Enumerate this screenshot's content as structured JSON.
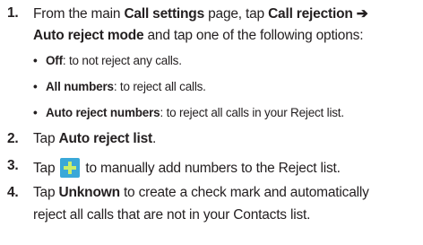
{
  "steps": [
    {
      "number": "1.",
      "line1": {
        "t1": "From the main ",
        "b1": "Call settings",
        "t2": " page, tap ",
        "b2": "Call rejection",
        "arrow": " ➔"
      },
      "line2": {
        "b1": "Auto reject mode",
        "t1": " and tap one of the following options:"
      },
      "bullets": [
        {
          "symbol": "•",
          "label": "Off",
          "text": ": to not reject any calls."
        },
        {
          "symbol": "•",
          "label": "All numbers",
          "text": ": to reject all calls."
        },
        {
          "symbol": "•",
          "label": "Auto reject numbers",
          "text": ": to reject all calls in your Reject list."
        }
      ]
    },
    {
      "number": "2.",
      "line1": {
        "t1": "Tap ",
        "b1": "Auto reject list",
        "t2": "."
      }
    },
    {
      "number": "3.",
      "line1": {
        "t1": "Tap",
        "t2": "to manually add numbers to the Reject list."
      },
      "icon": "plus-add-icon",
      "icon_colors": {
        "background": "#3aa8d8",
        "plus": "#c9ee6a"
      }
    },
    {
      "number": "4.",
      "line1": {
        "t1": "Tap ",
        "b1": "Unknown",
        "t2": " to create a check mark and automatically"
      },
      "line2": {
        "t1": "reject all calls that are not in your Contacts list."
      }
    }
  ],
  "colors": {
    "text": "#231f20",
    "background": "#ffffff"
  }
}
